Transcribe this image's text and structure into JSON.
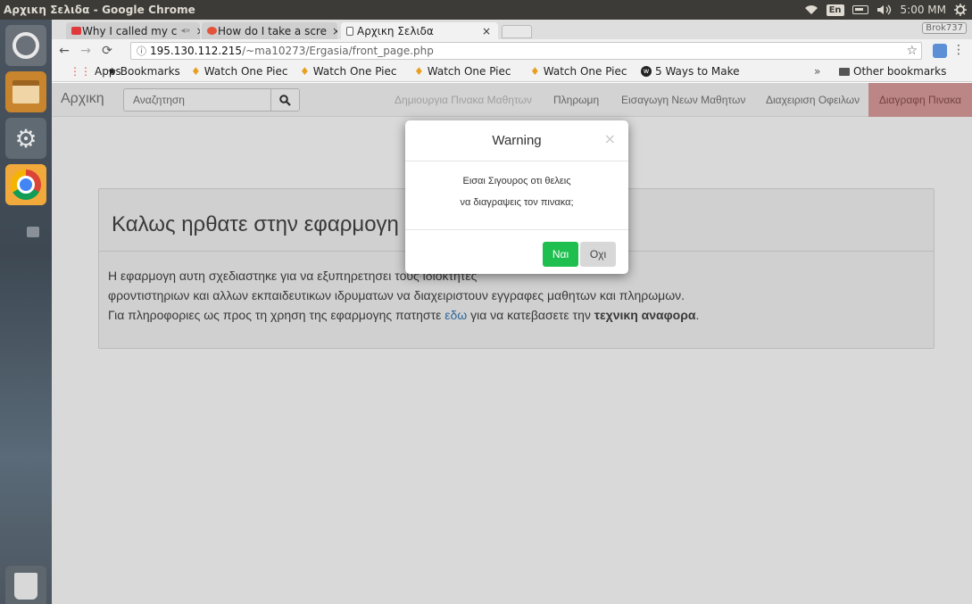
{
  "os": {
    "window_title": "Αρχικη Σελιδα - Google Chrome",
    "keyboard_layout": "En",
    "clock": "5:00 ΜΜ"
  },
  "browser": {
    "tabs": [
      {
        "label": "Why I called my c",
        "sound_icon": "◂»",
        "close": "×",
        "favicon_color": "#e0393b"
      },
      {
        "label": "How do I take a scre",
        "close": "×",
        "favicon_color": "#e2533a"
      },
      {
        "label": "Αρχικη Σελιδα",
        "close": "×",
        "favicon_color": "#ffffff"
      }
    ],
    "profile": "Brok737",
    "url_host": "195.130.112.215",
    "url_path": "/~ma10273/Ergasia/front_page.php",
    "bookmarks": [
      {
        "label": "Apps",
        "icon": "apps-grid-icon"
      },
      {
        "label": "Bookmarks",
        "icon": "star-icon"
      },
      {
        "label": "Watch One Piec",
        "icon": "onepiece-icon"
      },
      {
        "label": "Watch One Piec",
        "icon": "onepiece-icon"
      },
      {
        "label": "Watch One Piec",
        "icon": "onepiece-icon"
      },
      {
        "label": "Watch One Piec",
        "icon": "onepiece-icon"
      },
      {
        "label": "5 Ways to Make",
        "icon": "wikihow-icon"
      }
    ],
    "bookmarks_overflow": "»",
    "other_bookmarks": "Other bookmarks"
  },
  "page": {
    "navbar": {
      "brand": "Αρχικη",
      "search_placeholder": "Αναζητηση",
      "links": [
        {
          "label": "Δημιουργια Πινακα Μαθητων"
        },
        {
          "label": "Πληρωμη"
        },
        {
          "label": "Εισαγωγη Νεων Μαθητων"
        },
        {
          "label": "Διαχειριση Οφειλων"
        },
        {
          "label": "Διαγραφη Πινακα"
        }
      ]
    },
    "jumbotron": {
      "title": "Καλως ηρθατε στην εφαρμογη",
      "line1": "Η εφαρμογη αυτη σχεδιαστηκε για να εξυπηρετησει τους ιδιοκτητες",
      "line2": "φροντιστηριων και αλλων εκπαιδευτικων ιδρυματων να διαχειριστουν εγγραφες μαθητων και πληρωμων.",
      "line3_pre": "Για πληροφοριες ως προς τη χρηση της εφαρμογης πατηστε ",
      "line3_link": "εδω",
      "line3_mid": " για να κατεβασετε την ",
      "line3_bold": "τεχνικη αναφορα",
      "line3_end": "."
    },
    "modal": {
      "title": "Warning",
      "close": "×",
      "message_line1": "Εισαι Σιγουρος οτι θελεις",
      "message_line2": "να διαγραψεις τον πινακα;",
      "yes_label": "Ναι",
      "no_label": "Οχι"
    }
  }
}
